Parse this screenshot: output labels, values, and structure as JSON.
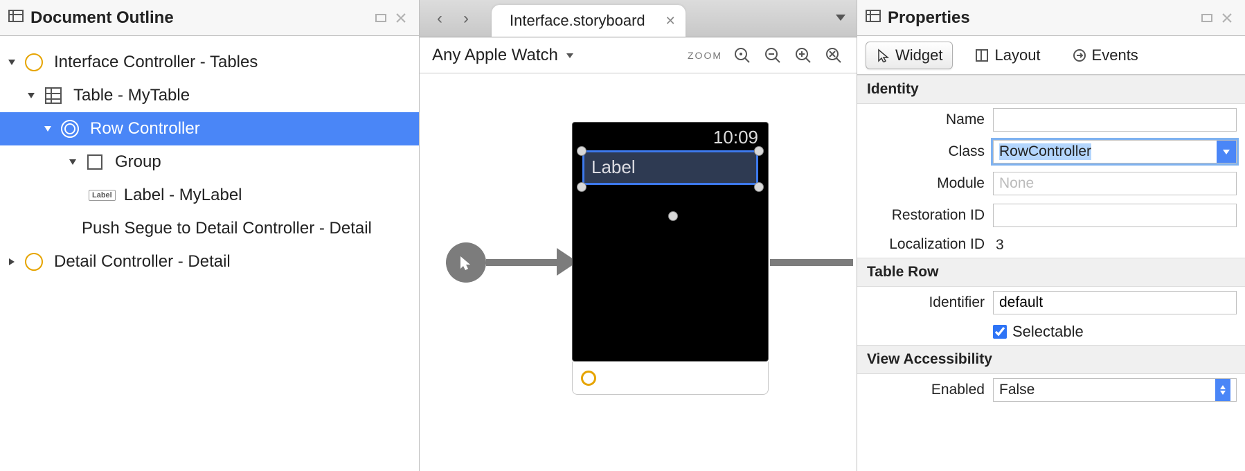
{
  "left": {
    "title": "Document Outline",
    "tree": {
      "root": "Interface Controller - Tables",
      "table": "Table - MyTable",
      "row_controller": "Row Controller",
      "group": "Group",
      "label_badge": "Label",
      "label_item": "Label - MyLabel",
      "segue": "Push Segue to Detail Controller - Detail",
      "detail": "Detail Controller - Detail"
    }
  },
  "center": {
    "tab_title": "Interface.storyboard",
    "device": "Any Apple Watch",
    "zoom_label": "ZOOM",
    "watch_time": "10:09",
    "label_text": "Label"
  },
  "right": {
    "title": "Properties",
    "tabs": {
      "widget": "Widget",
      "layout": "Layout",
      "events": "Events"
    },
    "sections": {
      "identity": "Identity",
      "table_row": "Table Row",
      "view_accessibility": "View Accessibility"
    },
    "fields": {
      "name_label": "Name",
      "name_value": "",
      "class_label": "Class",
      "class_value": "RowController",
      "module_label": "Module",
      "module_placeholder": "None",
      "restoration_label": "Restoration ID",
      "restoration_value": "",
      "localization_label": "Localization ID",
      "localization_value": "3",
      "identifier_label": "Identifier",
      "identifier_value": "default",
      "selectable_label": "Selectable",
      "enabled_label": "Enabled",
      "enabled_value": "False"
    }
  }
}
